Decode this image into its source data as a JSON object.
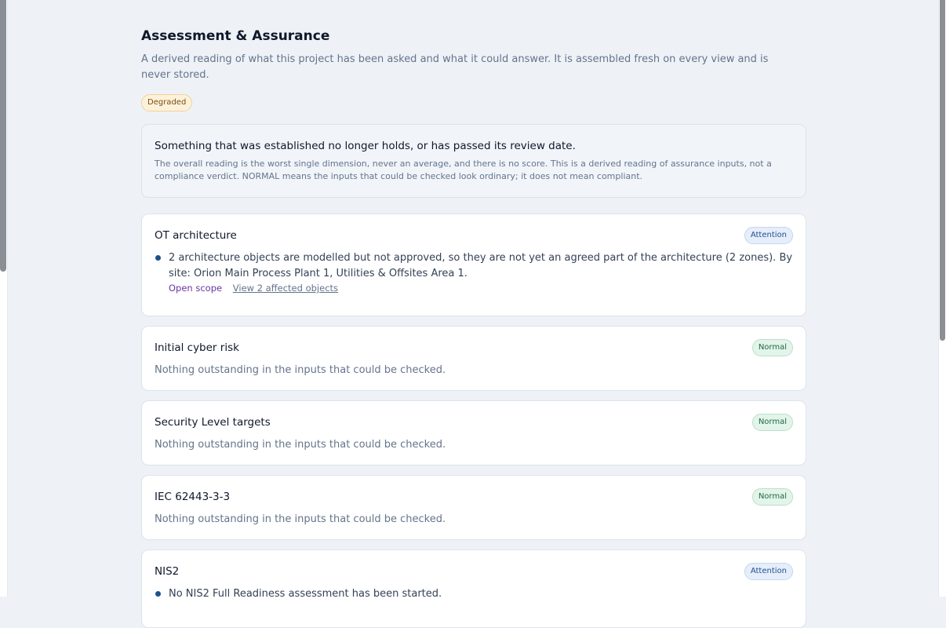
{
  "page": {
    "title": "Assessment & Assurance",
    "subtitle": "A derived reading of what this project has been asked and what it could answer. It is assembled fresh on every view and is never stored.",
    "overall_status": "Degraded"
  },
  "summary": {
    "headline": "Something that was established no longer holds, or has passed its review date.",
    "note": "The overall reading is the worst single dimension, never an average, and there is no score. This is a derived reading of assurance inputs, not a compliance verdict. NORMAL means the inputs that could be checked look ordinary; it does not mean compliant."
  },
  "dimensions": [
    {
      "title": "OT architecture",
      "status": "Attention",
      "finding": "2 architecture objects are modelled but not approved, so they are not yet an agreed part of the architecture (2 zones). By site: Orion Main Process Plant 1, Utilities & Offsites Area 1.",
      "link_scope": "Open scope",
      "link_objects": "View 2 affected objects"
    },
    {
      "title": "Initial cyber risk",
      "status": "Normal",
      "body": "Nothing outstanding in the inputs that could be checked."
    },
    {
      "title": "Security Level targets",
      "status": "Normal",
      "body": "Nothing outstanding in the inputs that could be checked."
    },
    {
      "title": "IEC 62443-3-3",
      "status": "Normal",
      "body": "Nothing outstanding in the inputs that could be checked."
    },
    {
      "title": "NIS2",
      "status": "Attention",
      "finding": "No NIS2 Full Readiness assessment has been started."
    }
  ],
  "colors": {
    "degraded": "#fdf2d9",
    "attention": "#e6eefb",
    "normal": "#e3f4ea",
    "link": "#6b34a3"
  }
}
